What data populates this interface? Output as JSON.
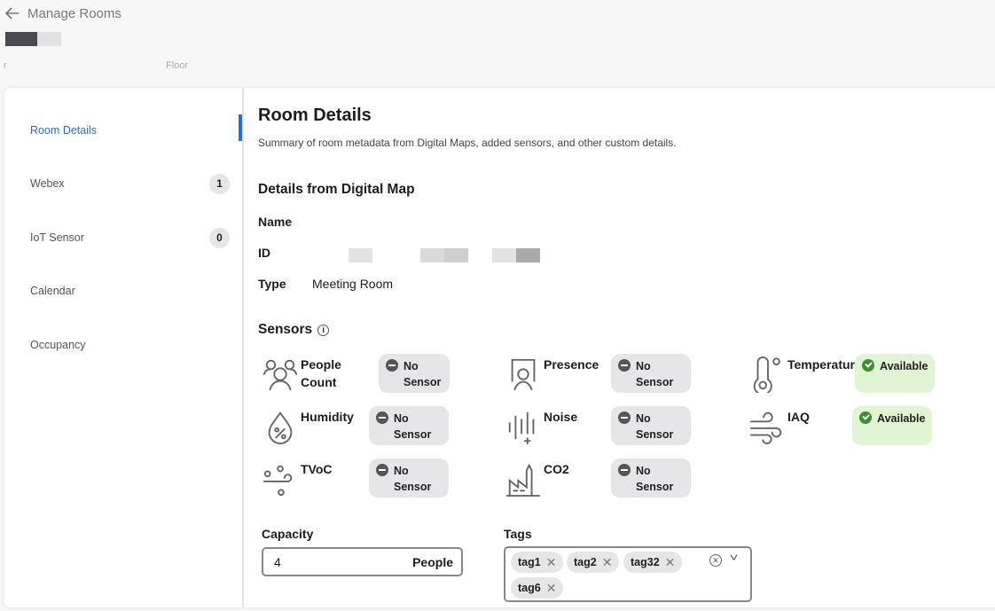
{
  "header": {
    "back_label": "Manage Rooms",
    "location_prefix": "r",
    "location_floor": "Floor"
  },
  "sidebar": {
    "items": [
      {
        "label": "Room Details",
        "active": true
      },
      {
        "label": "Webex",
        "count": "1"
      },
      {
        "label": "IoT Sensor",
        "count": "0"
      },
      {
        "label": "Calendar"
      },
      {
        "label": "Occupancy"
      }
    ]
  },
  "main": {
    "title": "Room Details",
    "subtitle": "Summary of room metadata from Digital Maps, added sensors, and other custom details.",
    "digital_map": {
      "heading": "Details from Digital Map",
      "name_label": "Name",
      "id_label": "ID",
      "type_label": "Type",
      "type_value": "Meeting Room"
    },
    "sensors": {
      "heading": "Sensors",
      "items": [
        {
          "label": "People Count",
          "status": "No Sensor",
          "icon": "people-count-icon"
        },
        {
          "label": "Presence",
          "status": "No Sensor",
          "icon": "presence-icon"
        },
        {
          "label": "Temperature",
          "status": "Available",
          "icon": "thermometer-icon"
        },
        {
          "label": "Humidity",
          "status": "No Sensor",
          "icon": "humidity-icon"
        },
        {
          "label": "Noise",
          "status": "No Sensor",
          "icon": "noise-icon"
        },
        {
          "label": "IAQ",
          "status": "Available",
          "icon": "wind-icon"
        },
        {
          "label": "TVoC",
          "status": "No Sensor",
          "icon": "tvoc-icon"
        },
        {
          "label": "CO2",
          "status": "No Sensor",
          "icon": "factory-icon"
        }
      ]
    },
    "capacity": {
      "label": "Capacity",
      "value": "4",
      "unit": "People"
    },
    "tags": {
      "label": "Tags",
      "values": [
        "tag1",
        "tag2",
        "tag32",
        "tag6"
      ]
    },
    "colors": {
      "accent": "#2f6fc0",
      "available_bg": "#dff5d3",
      "available_icon": "#3c8f2e",
      "no_sensor_bg": "#e6e6e8"
    }
  }
}
